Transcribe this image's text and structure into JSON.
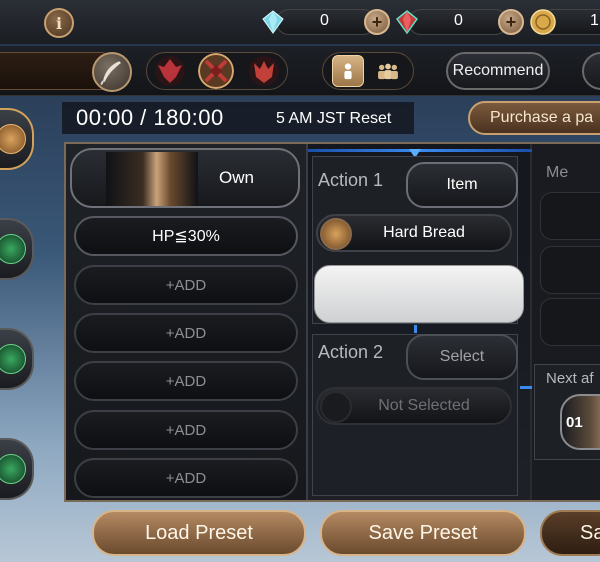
{
  "header": {
    "info_label": "i",
    "currencies": [
      {
        "icon": "blue-crystal-icon",
        "value": "0"
      },
      {
        "icon": "red-crystal-icon",
        "value": "0"
      },
      {
        "icon": "gold-coin-icon",
        "value": "1"
      }
    ],
    "plus_label": "+"
  },
  "toolbar": {
    "recommend_label": "Recommend",
    "party_emblems": [
      "red-crest-icon",
      "crossed-swords-icon",
      "demon-crest-icon"
    ]
  },
  "timer": {
    "elapsed": "00:00 / 180:00",
    "reset_text": "5 AM JST Reset"
  },
  "purchase_label": "Purchase a pa",
  "condition_column": {
    "own_label": "Own",
    "conditions": [
      "HP≦30%",
      "+ADD",
      "+ADD",
      "+ADD",
      "+ADD",
      "+ADD"
    ]
  },
  "actions": [
    {
      "title": "Action 1",
      "button": "Item",
      "selection": "Hard Bread"
    },
    {
      "title": "Action 2",
      "button": "Select",
      "selection": "Not Selected"
    }
  ],
  "right_panel": {
    "me_label": "Me",
    "next_label": "Next af",
    "next_number": "01"
  },
  "footer": {
    "load_label": "Load Preset",
    "save_label": "Save Preset",
    "third_label": "Sa"
  },
  "colors": {
    "accent_gold": "#c8a070",
    "accent_blue": "#3a8af0"
  }
}
